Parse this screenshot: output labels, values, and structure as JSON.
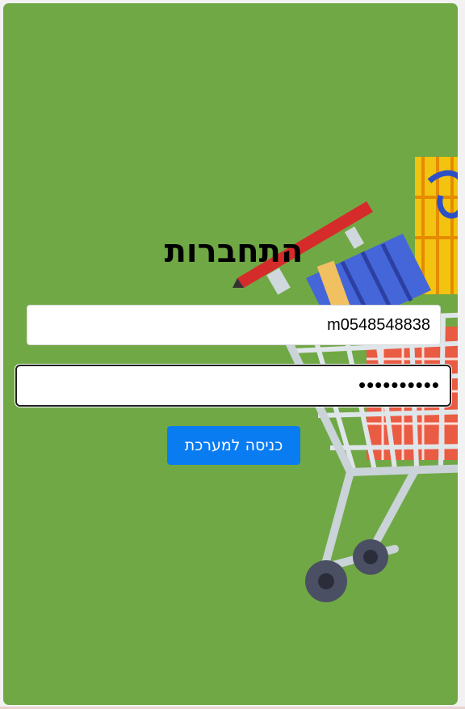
{
  "login": {
    "title": "התחברות",
    "phone_value": "m0548548838",
    "password_masked": "••••••••••",
    "submit_label": "כניסה למערכת"
  },
  "colors": {
    "background": "#70a845",
    "button": "#0a7cf2"
  },
  "illustration": {
    "icon": "shopping-cart-icon"
  }
}
